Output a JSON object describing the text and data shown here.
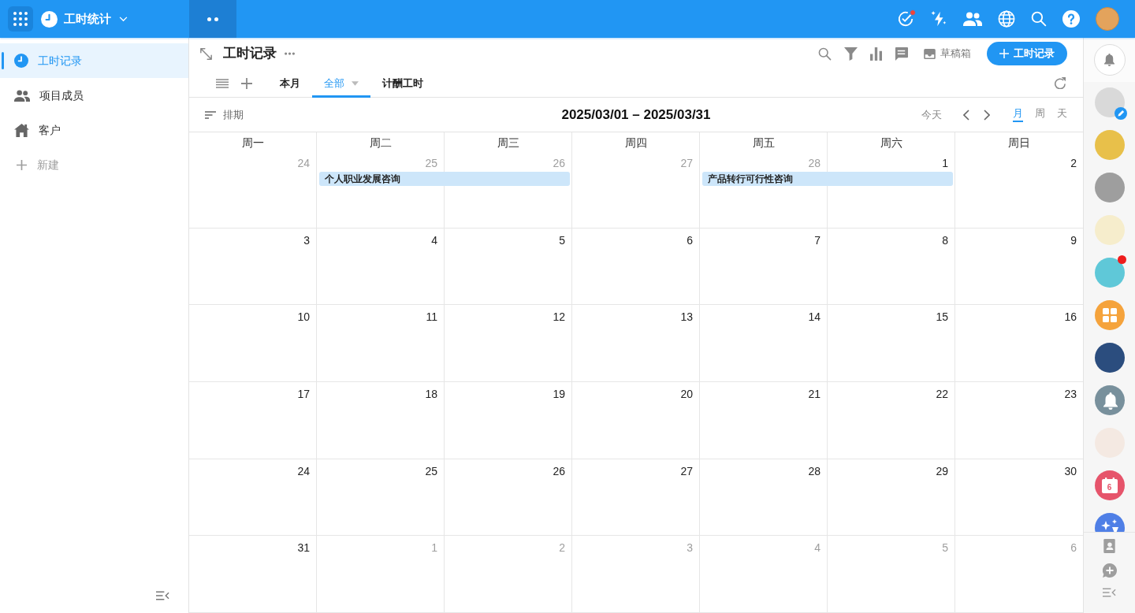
{
  "app": {
    "title": "工时统计",
    "tasks_alert": true
  },
  "sidebar": {
    "items": [
      {
        "label": "工时记录",
        "selected": true
      },
      {
        "label": "项目成员",
        "selected": false
      },
      {
        "label": "客户",
        "selected": false
      }
    ],
    "new_label": "新建"
  },
  "view": {
    "title": "工时记录",
    "tabs": [
      {
        "label": "本月",
        "selected": false,
        "dropdown": false
      },
      {
        "label": "全部",
        "selected": true,
        "dropdown": true
      },
      {
        "label": "计酬工时",
        "selected": false,
        "dropdown": false
      }
    ],
    "drafts_label": "草稿箱",
    "add_label": "工时记录"
  },
  "calendar": {
    "sort_label": "排期",
    "range": "2025/03/01 – 2025/03/31",
    "today_label": "今天",
    "modes": [
      {
        "label": "月",
        "selected": true
      },
      {
        "label": "周",
        "selected": false
      },
      {
        "label": "天",
        "selected": false
      }
    ],
    "weekdays": [
      "周一",
      "周二",
      "周三",
      "周四",
      "周五",
      "周六",
      "周日"
    ],
    "weeks": [
      {
        "days": [
          {
            "label": "24",
            "outside": true
          },
          {
            "label": "25",
            "outside": true,
            "events": [
              {
                "title": "个人职业发展咨询",
                "spans_next_day": true
              }
            ]
          },
          {
            "label": "26",
            "outside": true
          },
          {
            "label": "27",
            "outside": true
          },
          {
            "label": "28",
            "outside": true,
            "events": [
              {
                "title": "产品转行可行性咨询",
                "spans_next_day": true
              }
            ]
          },
          {
            "label": "1",
            "outside": false
          },
          {
            "label": "2",
            "outside": false
          }
        ]
      },
      {
        "days": [
          {
            "label": "3",
            "outside": false
          },
          {
            "label": "4",
            "outside": false
          },
          {
            "label": "5",
            "outside": false
          },
          {
            "label": "6",
            "outside": false
          },
          {
            "label": "7",
            "outside": false
          },
          {
            "label": "8",
            "outside": false
          },
          {
            "label": "9",
            "outside": false
          }
        ]
      },
      {
        "days": [
          {
            "label": "10",
            "outside": false
          },
          {
            "label": "11",
            "outside": false
          },
          {
            "label": "12",
            "outside": false
          },
          {
            "label": "13",
            "outside": false
          },
          {
            "label": "14",
            "outside": false
          },
          {
            "label": "15",
            "outside": false
          },
          {
            "label": "16",
            "outside": false
          }
        ]
      },
      {
        "days": [
          {
            "label": "17",
            "outside": false
          },
          {
            "label": "18",
            "outside": false
          },
          {
            "label": "19",
            "outside": false
          },
          {
            "label": "20",
            "outside": false
          },
          {
            "label": "21",
            "outside": false
          },
          {
            "label": "22",
            "outside": false
          },
          {
            "label": "23",
            "outside": false
          }
        ]
      },
      {
        "days": [
          {
            "label": "24",
            "outside": false
          },
          {
            "label": "25",
            "outside": false
          },
          {
            "label": "26",
            "outside": false
          },
          {
            "label": "27",
            "outside": false
          },
          {
            "label": "28",
            "outside": false
          },
          {
            "label": "29",
            "outside": false
          },
          {
            "label": "30",
            "outside": false
          }
        ]
      },
      {
        "days": [
          {
            "label": "31",
            "outside": false
          },
          {
            "label": "1",
            "outside": true
          },
          {
            "label": "2",
            "outside": true
          },
          {
            "label": "3",
            "outside": true
          },
          {
            "label": "4",
            "outside": true
          },
          {
            "label": "5",
            "outside": true
          },
          {
            "label": "6",
            "outside": true
          }
        ]
      }
    ]
  },
  "dock": {
    "items": [
      {
        "kind": "avatar",
        "color": "#d9d9d9",
        "edit_badge": true,
        "unread": false
      },
      {
        "kind": "avatar",
        "color": "#e8c04a",
        "edit_badge": false,
        "unread": false
      },
      {
        "kind": "avatar",
        "color": "#9e9e9e",
        "edit_badge": false,
        "unread": false
      },
      {
        "kind": "avatar",
        "color": "#f6edcc",
        "edit_badge": false,
        "unread": false
      },
      {
        "kind": "avatar",
        "color": "#5fc8d8",
        "edit_badge": false,
        "unread": true
      },
      {
        "kind": "apps",
        "color": "#f5a33c",
        "edit_badge": false,
        "unread": false
      },
      {
        "kind": "photo",
        "color": "#2b4d7e",
        "edit_badge": false,
        "unread": false
      },
      {
        "kind": "bell",
        "color": "#78909c",
        "edit_badge": false,
        "unread": false
      },
      {
        "kind": "avatar",
        "color": "#f4e9e2",
        "edit_badge": false,
        "unread": false
      },
      {
        "kind": "calendar",
        "color": "#e6546b",
        "text": "6",
        "edit_badge": false,
        "unread": false
      },
      {
        "kind": "sparkle",
        "color": "#4f7fe6",
        "edit_badge": false,
        "unread": false
      }
    ]
  }
}
